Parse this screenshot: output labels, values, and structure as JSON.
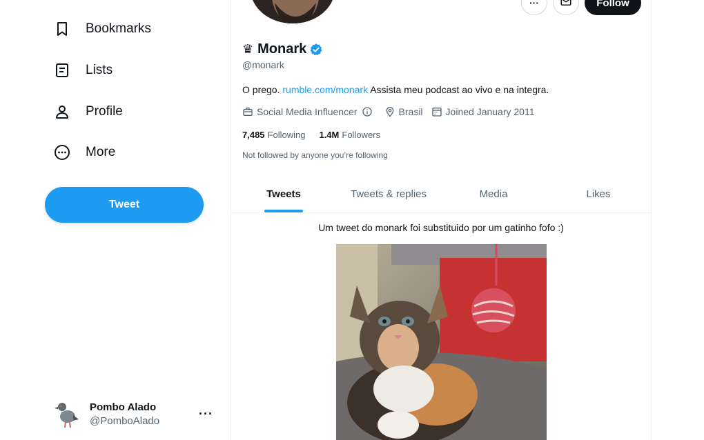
{
  "sidebar": {
    "items": [
      {
        "label": "Bookmarks",
        "icon": "bookmark-icon"
      },
      {
        "label": "Lists",
        "icon": "lists-icon"
      },
      {
        "label": "Profile",
        "icon": "profile-icon"
      },
      {
        "label": "More",
        "icon": "more-circle-icon"
      }
    ],
    "tweet_button": "Tweet",
    "account": {
      "name": "Pombo Alado",
      "handle": "@PomboAlado",
      "more": "···"
    }
  },
  "profile": {
    "crown": "♛",
    "name": "Monark",
    "handle": "@monark",
    "bio_prefix": "O prego.",
    "bio_link": "rumble.com/monark",
    "bio_suffix": "Assista meu podcast ao vivo e na integra.",
    "category": "Social Media Influencer",
    "location": "Brasil",
    "joined": "Joined January 2011",
    "following_count": "7,485",
    "following_label": "Following",
    "followers_count": "1.4M",
    "followers_label": "Followers",
    "not_followed": "Not followed by anyone you’re following",
    "follow_button": "Follow",
    "more_button": "···"
  },
  "tabs": [
    "Tweets",
    "Tweets & replies",
    "Media",
    "Likes"
  ],
  "active_tab": "Tweets",
  "post": {
    "caption": "Um tweet do monark foi substituido por um gatinho fofo :)"
  },
  "colors": {
    "accent": "#1d9bf0",
    "text": "#0f1419",
    "muted": "#536471",
    "follow_bg": "#0f1419"
  }
}
